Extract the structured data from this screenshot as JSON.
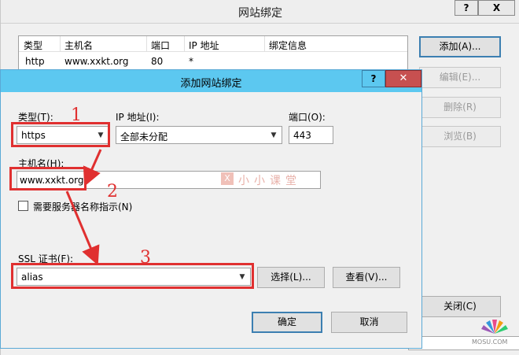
{
  "back_window": {
    "title": "网站绑定",
    "help_btn": "?",
    "close_btn": "X",
    "table": {
      "headers": [
        "类型",
        "主机名",
        "端口",
        "IP 地址",
        "绑定信息"
      ],
      "rows": [
        [
          "http",
          "www.xxkt.org",
          "80",
          "*",
          ""
        ]
      ]
    },
    "buttons": {
      "add": "添加(A)...",
      "edit": "编辑(E)...",
      "remove": "删除(R)",
      "browse": "浏览(B)",
      "close": "关闭(C)"
    }
  },
  "dialog": {
    "title": "添加网站绑定",
    "help_btn": "?",
    "close_btn": "✕",
    "type_label": "类型(T):",
    "type_value": "https",
    "ip_label": "IP 地址(I):",
    "ip_value": "全部未分配",
    "port_label": "端口(O):",
    "port_value": "443",
    "host_label": "主机名(H):",
    "host_value": "www.xxkt.org",
    "sni_label": "需要服务器名称指示(N)",
    "ssl_label": "SSL 证书(F):",
    "ssl_value": "alias",
    "select_btn": "选择(L)...",
    "view_btn": "查看(V)...",
    "ok_btn": "确定",
    "cancel_btn": "取消",
    "watermark": "小小课堂"
  },
  "annotations": {
    "step1": "1",
    "step2": "2",
    "step3": "3",
    "color": "#e03030"
  },
  "corner_logo_text": "MOSU.COM"
}
